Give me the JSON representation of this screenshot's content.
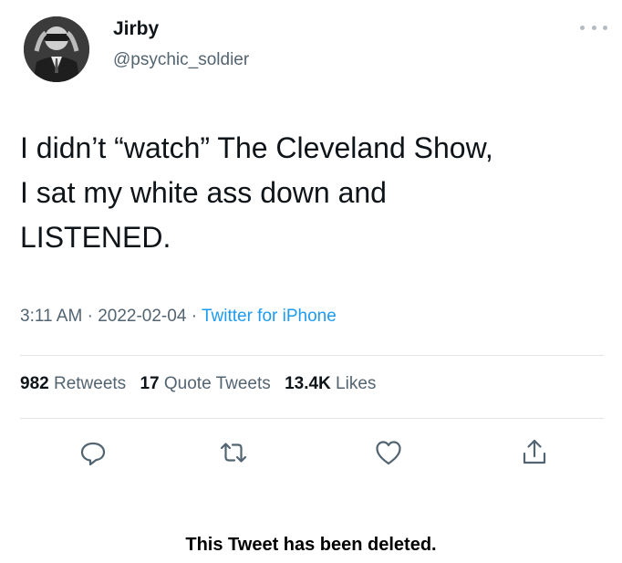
{
  "user": {
    "display_name": "Jirby",
    "handle": "@psychic_soldier"
  },
  "tweet": {
    "lines": [
      "I didn’t “watch” The Cleveland Show,",
      "I sat my white ass down and",
      "LISTENED."
    ],
    "time": "3:11 AM",
    "date": "2022-02-04",
    "separator": "·",
    "source": "Twitter for iPhone"
  },
  "stats": {
    "retweets_count": "982",
    "retweets_label": "Retweets",
    "quotes_count": "17",
    "quotes_label": "Quote Tweets",
    "likes_count": "13.4K",
    "likes_label": "Likes"
  },
  "actions": {
    "icons": [
      "reply-icon",
      "retweet-icon",
      "like-icon",
      "share-icon"
    ]
  },
  "notice": {
    "deleted": "This Tweet has been deleted."
  },
  "colors": {
    "text": "#0f1419",
    "secondary": "#536471",
    "link": "#1d9bf0",
    "divider": "#e2e6e9"
  }
}
